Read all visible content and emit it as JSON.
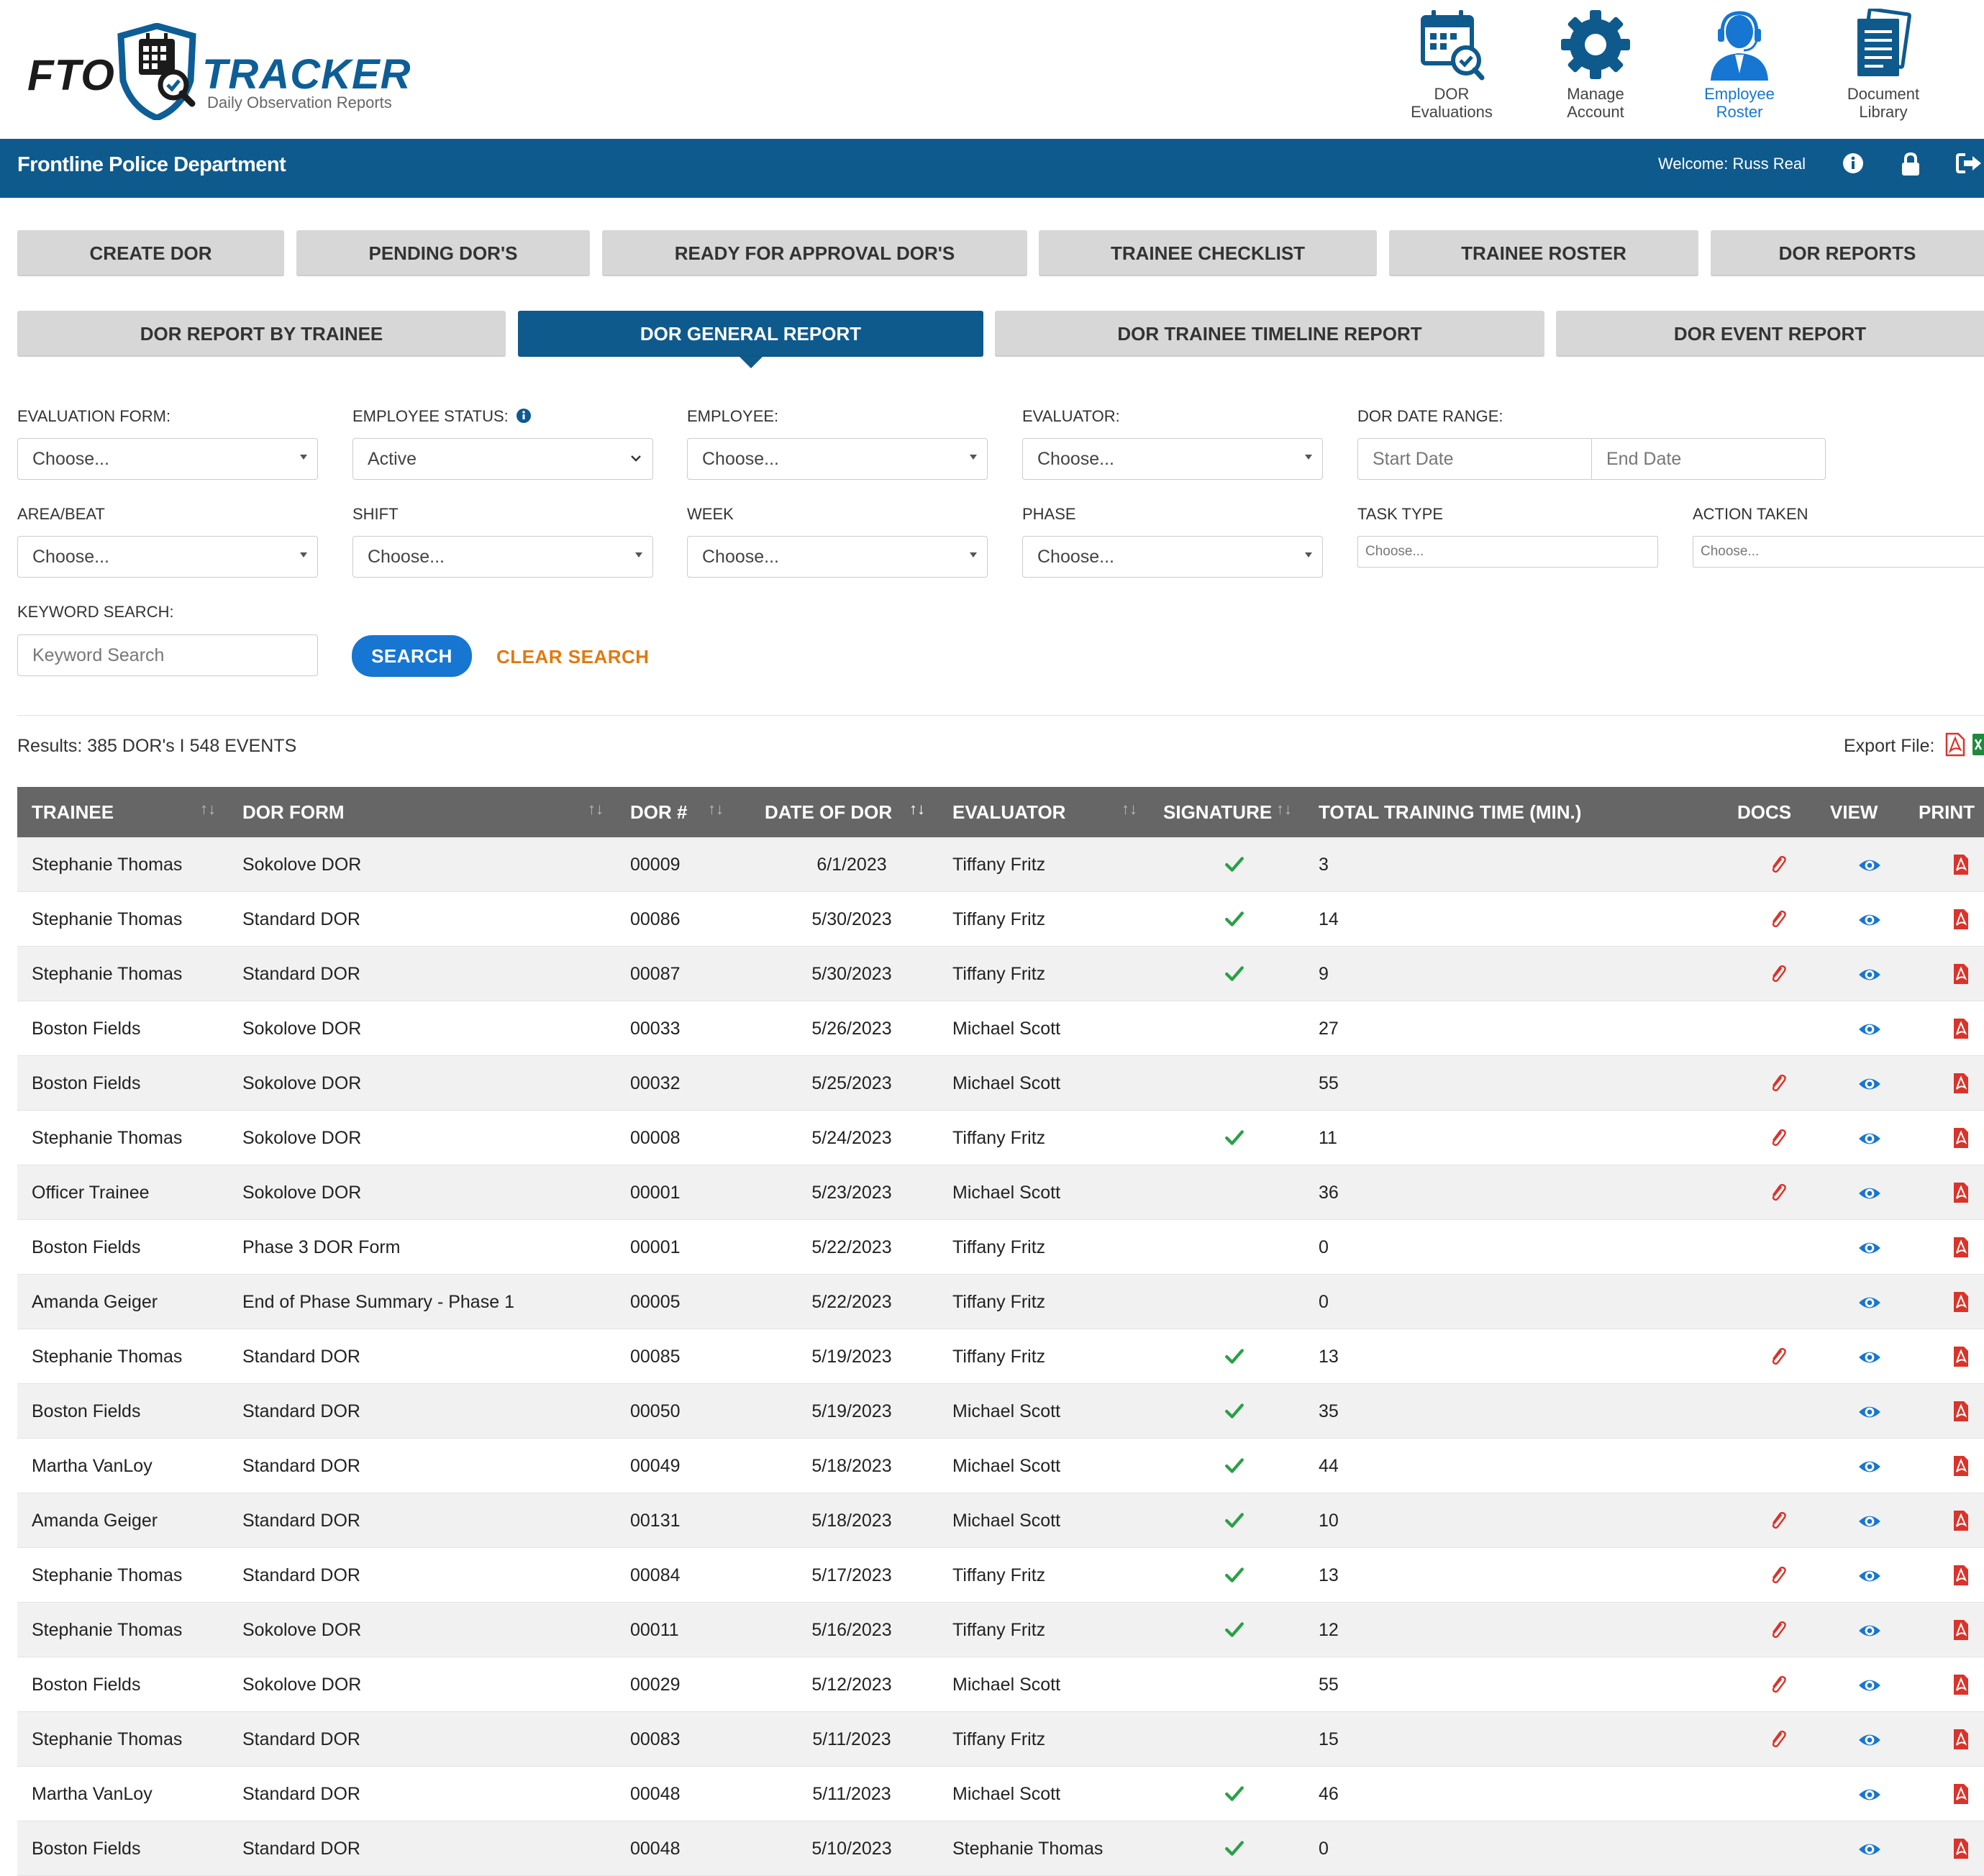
{
  "logo": {
    "left": "FTO",
    "right": "TRACKER",
    "subtitle": "Daily Observation Reports"
  },
  "topnav": [
    {
      "line1": "DOR",
      "line2": "Evaluations",
      "icon": "calendar-check-icon"
    },
    {
      "line1": "Manage",
      "line2": "Account",
      "icon": "gear-icon"
    },
    {
      "line1": "Employee",
      "line2": "Roster",
      "icon": "headset-person-icon",
      "active": true
    },
    {
      "line1": "Document",
      "line2": "Library",
      "icon": "documents-icon"
    }
  ],
  "header": {
    "department": "Frontline Police Department",
    "welcome": "Welcome: Russ Real",
    "icons": [
      "info-icon",
      "lock-icon",
      "logout-icon"
    ]
  },
  "tabs_primary": [
    "CREATE DOR",
    "PENDING DOR'S",
    "READY FOR APPROVAL DOR'S",
    "TRAINEE CHECKLIST",
    "TRAINEE ROSTER",
    "DOR REPORTS"
  ],
  "tabs_secondary": [
    "DOR REPORT BY TRAINEE",
    "DOR GENERAL REPORT",
    "DOR TRAINEE TIMELINE REPORT",
    "DOR EVENT REPORT"
  ],
  "active_secondary_tab": "DOR GENERAL REPORT",
  "filters": {
    "evaluation_form": {
      "label": "EVALUATION FORM:",
      "value": "Choose..."
    },
    "employee_status": {
      "label": "EMPLOYEE STATUS:",
      "value": "Active"
    },
    "employee": {
      "label": "EMPLOYEE:",
      "value": "Choose..."
    },
    "evaluator": {
      "label": "EVALUATOR:",
      "value": "Choose..."
    },
    "date_range": {
      "label": "DOR DATE RANGE:",
      "start_placeholder": "Start Date",
      "end_placeholder": "End Date"
    },
    "area_beat": {
      "label": "AREA/BEAT",
      "value": "Choose..."
    },
    "shift": {
      "label": "SHIFT",
      "value": "Choose..."
    },
    "week": {
      "label": "WEEK",
      "value": "Choose..."
    },
    "phase": {
      "label": "PHASE",
      "value": "Choose..."
    },
    "task_type": {
      "label": "TASK TYPE",
      "value": "Choose..."
    },
    "action_taken": {
      "label": "ACTION TAKEN",
      "value": "Choose..."
    },
    "keyword": {
      "label": "KEYWORD SEARCH:",
      "placeholder": "Keyword Search"
    },
    "search_button": "SEARCH",
    "clear_button": "CLEAR SEARCH"
  },
  "results": {
    "summary": "Results: 385 DOR's I 548 EVENTS",
    "export_label": "Export File:",
    "export_icons": [
      "pdf-icon",
      "excel-icon"
    ]
  },
  "table": {
    "columns": [
      "TRAINEE",
      "DOR FORM",
      "DOR #",
      "DATE OF DOR",
      "EVALUATOR",
      "SIGNATURE",
      "TOTAL TRAINING TIME (MIN.)",
      "DOCS",
      "VIEW",
      "PRINT"
    ],
    "rows": [
      {
        "trainee": "Stephanie Thomas",
        "form": "Sokolove DOR",
        "num": "00009",
        "date": "6/1/2023",
        "evaluator": "Tiffany Fritz",
        "signed": true,
        "time": "3",
        "docs": true
      },
      {
        "trainee": "Stephanie Thomas",
        "form": "Standard DOR",
        "num": "00086",
        "date": "5/30/2023",
        "evaluator": "Tiffany Fritz",
        "signed": true,
        "time": "14",
        "docs": true
      },
      {
        "trainee": "Stephanie Thomas",
        "form": "Standard DOR",
        "num": "00087",
        "date": "5/30/2023",
        "evaluator": "Tiffany Fritz",
        "signed": true,
        "time": "9",
        "docs": true
      },
      {
        "trainee": "Boston Fields",
        "form": "Sokolove DOR",
        "num": "00033",
        "date": "5/26/2023",
        "evaluator": "Michael Scott",
        "signed": false,
        "time": "27",
        "docs": false
      },
      {
        "trainee": "Boston Fields",
        "form": "Sokolove DOR",
        "num": "00032",
        "date": "5/25/2023",
        "evaluator": "Michael Scott",
        "signed": false,
        "time": "55",
        "docs": true
      },
      {
        "trainee": "Stephanie Thomas",
        "form": "Sokolove DOR",
        "num": "00008",
        "date": "5/24/2023",
        "evaluator": "Tiffany Fritz",
        "signed": true,
        "time": "11",
        "docs": true
      },
      {
        "trainee": "Officer Trainee",
        "form": "Sokolove DOR",
        "num": "00001",
        "date": "5/23/2023",
        "evaluator": "Michael Scott",
        "signed": false,
        "time": "36",
        "docs": true
      },
      {
        "trainee": "Boston Fields",
        "form": "Phase 3 DOR Form",
        "num": "00001",
        "date": "5/22/2023",
        "evaluator": "Tiffany Fritz",
        "signed": false,
        "time": "0",
        "docs": false
      },
      {
        "trainee": "Amanda Geiger",
        "form": "End of Phase Summary - Phase 1",
        "num": "00005",
        "date": "5/22/2023",
        "evaluator": "Tiffany Fritz",
        "signed": false,
        "time": "0",
        "docs": false
      },
      {
        "trainee": "Stephanie Thomas",
        "form": "Standard DOR",
        "num": "00085",
        "date": "5/19/2023",
        "evaluator": "Tiffany Fritz",
        "signed": true,
        "time": "13",
        "docs": true
      },
      {
        "trainee": "Boston Fields",
        "form": "Standard DOR",
        "num": "00050",
        "date": "5/19/2023",
        "evaluator": "Michael Scott",
        "signed": true,
        "time": "35",
        "docs": false
      },
      {
        "trainee": "Martha VanLoy",
        "form": "Standard DOR",
        "num": "00049",
        "date": "5/18/2023",
        "evaluator": "Michael Scott",
        "signed": true,
        "time": "44",
        "docs": false
      },
      {
        "trainee": "Amanda Geiger",
        "form": "Standard DOR",
        "num": "00131",
        "date": "5/18/2023",
        "evaluator": "Michael Scott",
        "signed": true,
        "time": "10",
        "docs": true
      },
      {
        "trainee": "Stephanie Thomas",
        "form": "Standard DOR",
        "num": "00084",
        "date": "5/17/2023",
        "evaluator": "Tiffany Fritz",
        "signed": true,
        "time": "13",
        "docs": true
      },
      {
        "trainee": "Stephanie Thomas",
        "form": "Sokolove DOR",
        "num": "00011",
        "date": "5/16/2023",
        "evaluator": "Tiffany Fritz",
        "signed": true,
        "time": "12",
        "docs": true
      },
      {
        "trainee": "Boston Fields",
        "form": "Sokolove DOR",
        "num": "00029",
        "date": "5/12/2023",
        "evaluator": "Michael Scott",
        "signed": false,
        "time": "55",
        "docs": true
      },
      {
        "trainee": "Stephanie Thomas",
        "form": "Standard DOR",
        "num": "00083",
        "date": "5/11/2023",
        "evaluator": "Tiffany Fritz",
        "signed": false,
        "time": "15",
        "docs": true
      },
      {
        "trainee": "Martha VanLoy",
        "form": "Standard DOR",
        "num": "00048",
        "date": "5/11/2023",
        "evaluator": "Michael Scott",
        "signed": true,
        "time": "46",
        "docs": false
      },
      {
        "trainee": "Boston Fields",
        "form": "Standard DOR",
        "num": "00048",
        "date": "5/10/2023",
        "evaluator": "Stephanie Thomas",
        "signed": true,
        "time": "0",
        "docs": false
      }
    ]
  },
  "colors": {
    "brand_blue": "#0f5a8d",
    "accent_blue": "#1676d2",
    "clear_orange": "#e07a10",
    "check_green": "#2aa047",
    "pdf_red": "#d9342b",
    "header_gray": "#666666"
  }
}
